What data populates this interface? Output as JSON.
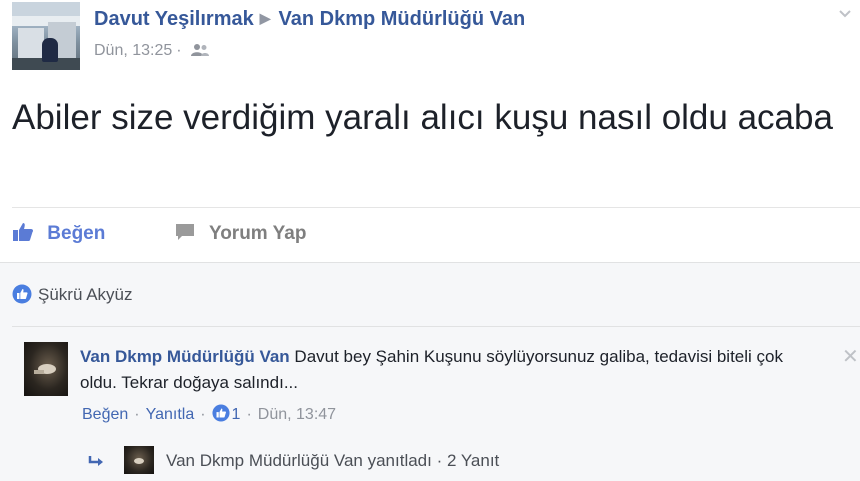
{
  "post": {
    "author": "Davut Yeşilırmak",
    "separator": "▶",
    "target_page": "Van Dkmp Müdürlüğü Van",
    "timestamp": "Dün, 13:25",
    "meta_dot": "·",
    "audience_icon": "friends-icon",
    "text": "Abiler size verdiğim yaralı alıcı kuşu nasıl oldu acaba"
  },
  "actions": {
    "like_label": "Beğen",
    "comment_label": "Yorum Yap"
  },
  "likes": {
    "names": "Şükrü Akyüz"
  },
  "comment": {
    "author": "Van Dkmp Müdürlüğü Van",
    "text": "Davut bey Şahin Kuşunu söylüyorsunuz galiba, tedavisi biteli çok oldu. Tekrar doğaya salındı...",
    "like_label": "Beğen",
    "reply_label": "Yanıtla",
    "like_count": "1",
    "timestamp": "Dün, 13:47",
    "dot": "·",
    "close_glyph": "✕"
  },
  "reply_summary": {
    "text": "Van Dkmp Müdürlüğü Van yanıtladı · 2 Yanıt"
  },
  "colors": {
    "link_blue": "#365899",
    "like_blue": "#5b7bd5",
    "muted": "#90949c",
    "comments_bg": "#f6f7f9"
  }
}
